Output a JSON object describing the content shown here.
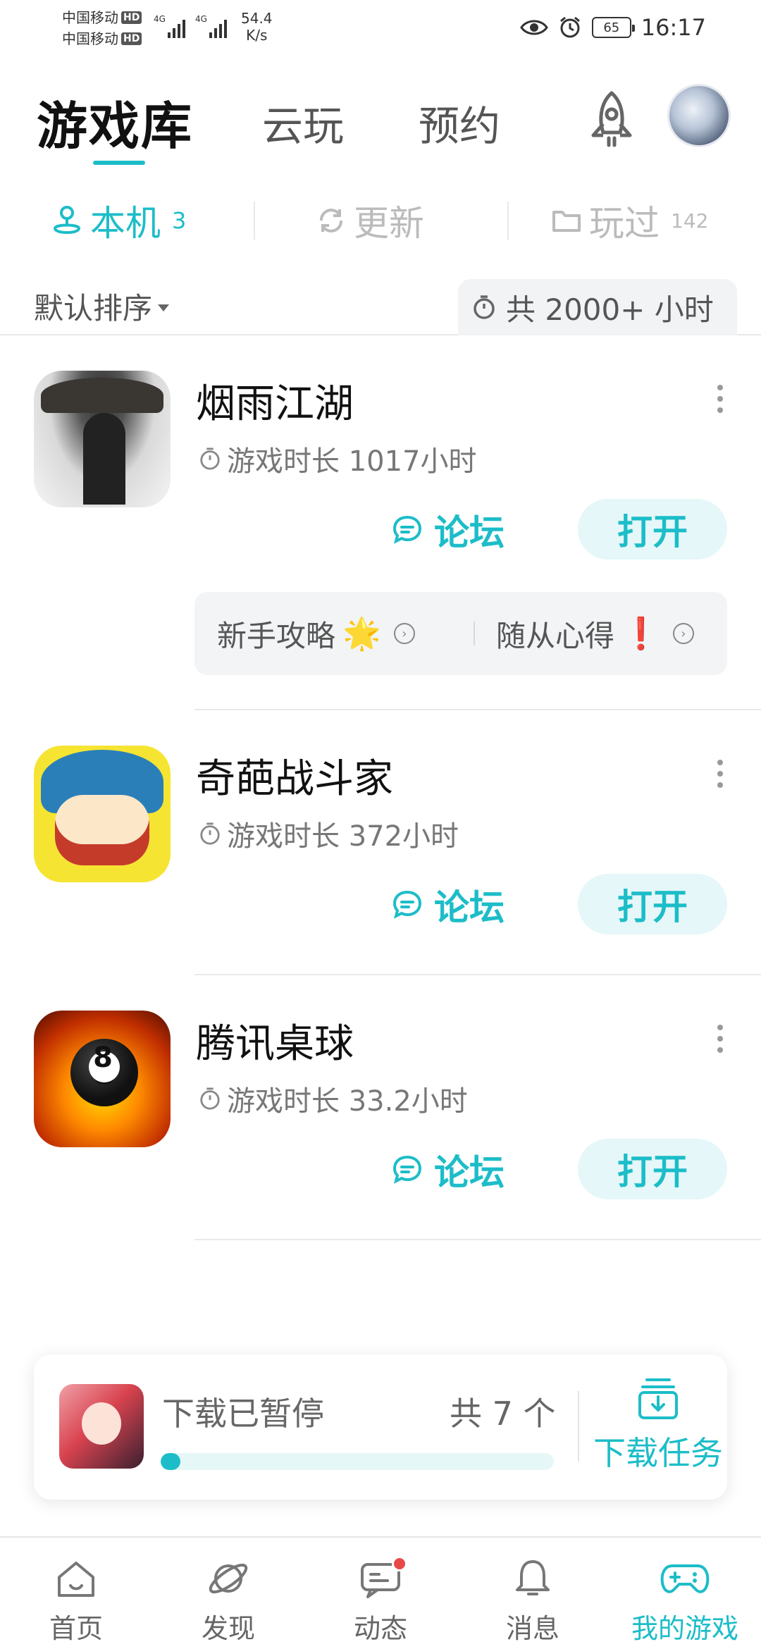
{
  "status_bar": {
    "carrier_1": "中国移动",
    "carrier_2": "中国移动",
    "hd": "HD",
    "network_1": "4G",
    "network_2": "4G",
    "speed_value": "54.4",
    "speed_unit": "K/s",
    "battery": "65",
    "time": "16:17"
  },
  "header": {
    "tabs": [
      {
        "label": "游戏库",
        "active": true
      },
      {
        "label": "云玩",
        "active": false
      },
      {
        "label": "预约",
        "active": false
      }
    ],
    "rocket_icon": "rocket-icon"
  },
  "subtabs": [
    {
      "label": "本机",
      "count": "3",
      "icon": "joystick-icon",
      "active": true
    },
    {
      "label": "更新",
      "count": "",
      "icon": "refresh-icon",
      "active": false
    },
    {
      "label": "玩过",
      "count": "142",
      "icon": "folder-icon",
      "active": false
    }
  ],
  "sort": {
    "label": "默认排序",
    "total": "共 2000+ 小时"
  },
  "games": [
    {
      "title": "烟雨江湖",
      "playtime": "游戏时长 1017小时",
      "forum": "论坛",
      "open": "打开"
    },
    {
      "title": "奇葩战斗家",
      "playtime": "游戏时长 372小时",
      "forum": "论坛",
      "open": "打开"
    },
    {
      "title": "腾讯桌球",
      "playtime": "游戏时长 33.2小时",
      "forum": "论坛",
      "open": "打开"
    }
  ],
  "icon_texts": {
    "game_3_ball": "8"
  },
  "guides": [
    {
      "label": "新手攻略",
      "emoji": "🌟"
    },
    {
      "label": "随从心得",
      "emoji": "❗"
    }
  ],
  "download": {
    "status": "下载已暂停",
    "count": "共 7 个",
    "progress": 0.05,
    "tasks_label": "下载任务"
  },
  "bottom_nav": [
    {
      "label": "首页",
      "icon": "home-icon",
      "active": false
    },
    {
      "label": "发现",
      "icon": "planet-icon",
      "active": false
    },
    {
      "label": "动态",
      "icon": "chat-icon",
      "active": false,
      "badge": true
    },
    {
      "label": "消息",
      "icon": "bell-icon",
      "active": false
    },
    {
      "label": "我的游戏",
      "icon": "gamepad-icon",
      "active": true
    }
  ],
  "colors": {
    "accent": "#1cbdc8",
    "accent_light": "#e5f7f8",
    "badge": "#e94848"
  }
}
